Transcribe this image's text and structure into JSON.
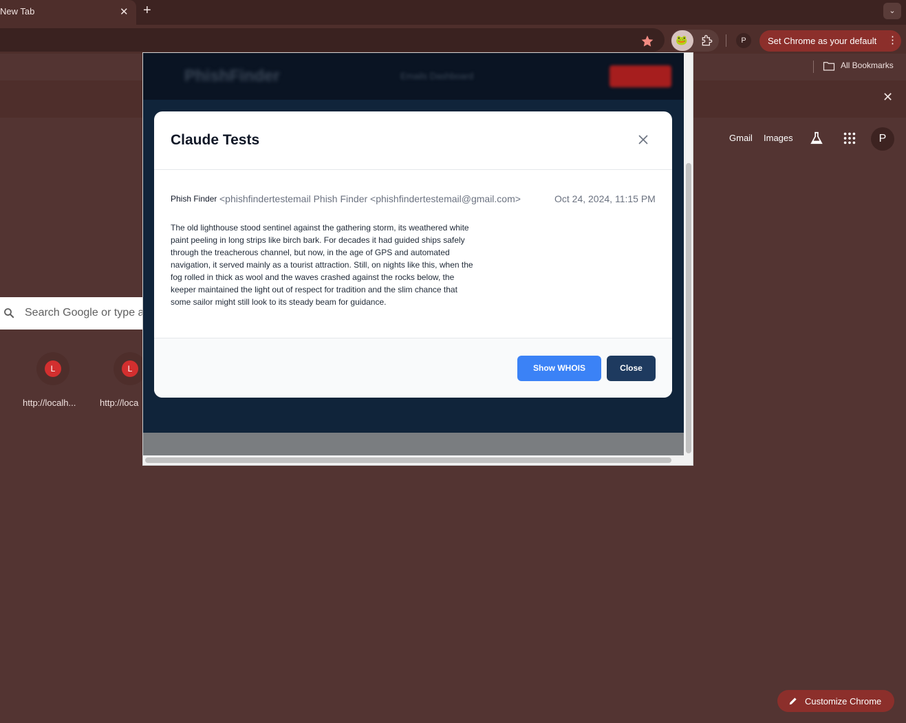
{
  "browser": {
    "tab_title": "New Tab",
    "tab_close": "✕",
    "new_tab": "+",
    "tab_menu": "⌄",
    "profile_initial": "P",
    "default_button": "Set Chrome as your default",
    "kebab": "⋮",
    "extension_emoji": "🐸"
  },
  "bookmarks": {
    "all_bookmarks": "All Bookmarks"
  },
  "infobar": {
    "close": "✕"
  },
  "ntp": {
    "gmail": "Gmail",
    "images": "Images",
    "profile_initial": "P",
    "search_placeholder": "Search Google or type a",
    "shortcuts": [
      {
        "letter": "L",
        "label": "http://localh..."
      },
      {
        "letter": "L",
        "label": "http://loca"
      }
    ],
    "customize": "Customize Chrome"
  },
  "popup": {
    "bg_logo": "PhishFinder",
    "bg_links": "Emails     Dashboard",
    "modal": {
      "title": "Claude Tests",
      "sender_name": "Phish Finder",
      "sender_email": "<phishfindertestemail Phish Finder <phishfindertestemail@gmail.com>",
      "date": "Oct 24, 2024, 11:15 PM",
      "body": "The old lighthouse stood sentinel against the gathering storm, its weathered white paint peeling in long strips like birch bark. For decades it had guided ships safely through the treacherous channel, but now, in the age of GPS and automated navigation, it served mainly as a tourist attraction. Still, on nights like this, when the fog rolled in thick as wool and the waves crashed against the rocks below, the keeper maintained the light out of respect for tradition and the slim chance that some sailor might still look to its steady beam for guidance.",
      "whois_button": "Show WHOIS",
      "close_button": "Close"
    }
  },
  "colors": {
    "page_bg": "#533432",
    "accent_red": "#8c2f2b",
    "whois_blue": "#3b82f6",
    "close_navy": "#1e3a5f"
  }
}
